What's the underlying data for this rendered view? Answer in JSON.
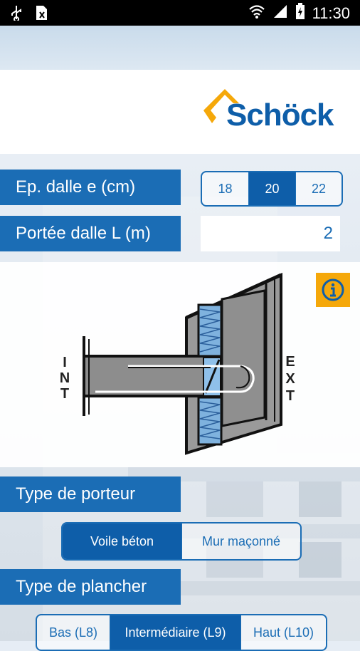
{
  "status_bar": {
    "time": "11:30"
  },
  "brand": {
    "logo_text": "Schöck"
  },
  "fields": {
    "thickness_label": "Ep. dalle e (cm)",
    "thickness_options": [
      "18",
      "20",
      "22"
    ],
    "thickness_selected": "20",
    "span_label": "Portée dalle L (m)",
    "span_value": "2"
  },
  "diagram": {
    "int_label": [
      "I",
      "N",
      "T"
    ],
    "ext_label": [
      "E",
      "X",
      "T"
    ]
  },
  "support_type": {
    "label": "Type de porteur",
    "options": [
      "Voile béton",
      "Mur maçonné"
    ],
    "selected": "Voile béton"
  },
  "floor_type": {
    "label": "Type de plancher",
    "options": [
      "Bas (L8)",
      "Intermédiaire (L9)",
      "Haut (L10)"
    ],
    "selected": "Intermédiaire (L9)"
  },
  "colors": {
    "primary": "#1b6db5",
    "dark": "#0e5ea9",
    "accent": "#f5a80a"
  }
}
